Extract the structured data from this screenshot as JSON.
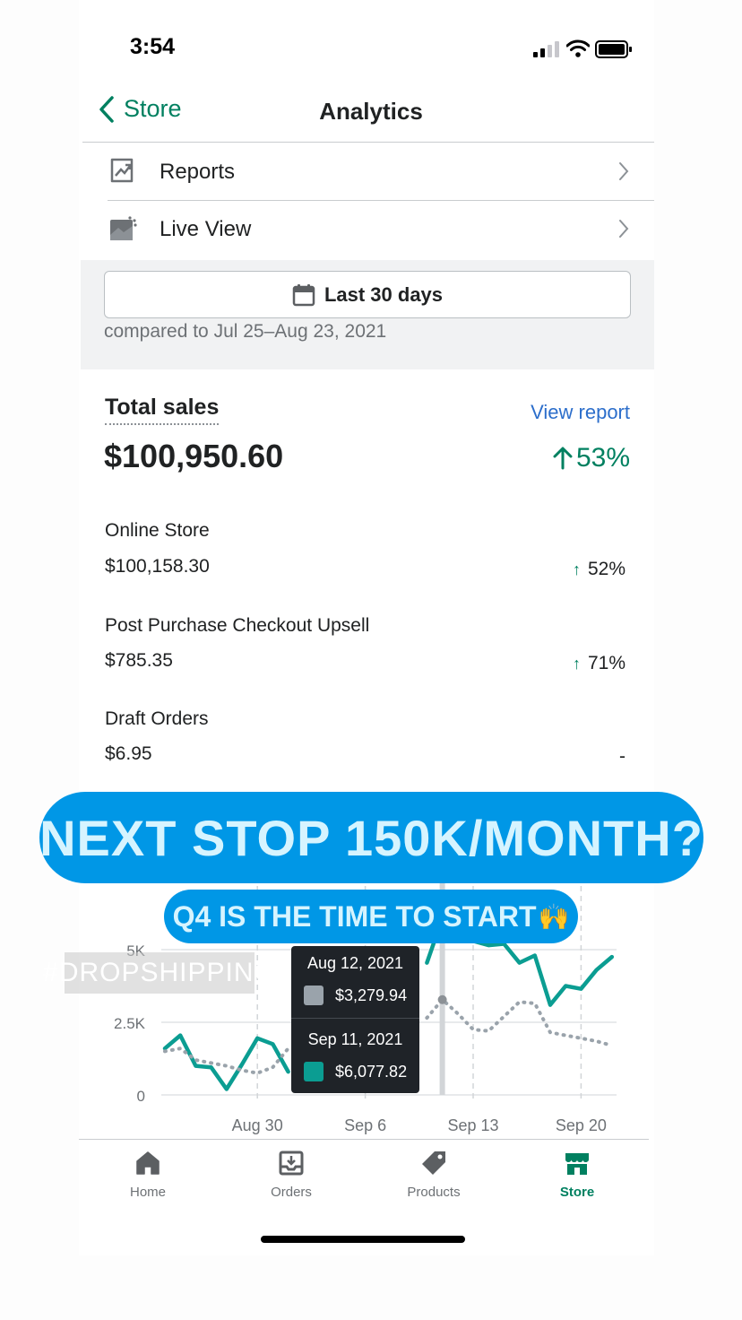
{
  "status": {
    "time": "3:54"
  },
  "nav": {
    "back_label": "Store",
    "title": "Analytics"
  },
  "menu": [
    {
      "label": "Reports",
      "icon": "reports-icon"
    },
    {
      "label": "Live View",
      "icon": "live-view-icon"
    }
  ],
  "date_filter": {
    "label": "Last 30 days",
    "compared": "compared to Jul 25–Aug 23, 2021"
  },
  "total_sales": {
    "label": "Total sales",
    "view_report": "View report",
    "value": "$100,950.60",
    "change": "53%"
  },
  "channels": [
    {
      "name": "Online Store",
      "value": "$100,158.30",
      "change": "52%"
    },
    {
      "name": "Post Purchase Checkout Upsell",
      "value": "$785.35",
      "change": "71%"
    },
    {
      "name": "Draft Orders",
      "value": "$6.95",
      "change": "-"
    }
  ],
  "overlay": {
    "headline": "NEXT STOP 150K/MONTH?",
    "subline": "Q4 IS THE TIME TO START",
    "subline_emoji": "🙌",
    "hashtag": "#DROPSHIPPING"
  },
  "chart_data": {
    "type": "line",
    "x_ticks": [
      "Aug 30",
      "Sep 6",
      "Sep 13",
      "Sep 20"
    ],
    "y_ticks": [
      "0",
      "2.5K",
      "5K"
    ],
    "ylim": [
      0,
      6000
    ],
    "grid": true,
    "series": [
      {
        "color": "#0b9d92",
        "style": "solid",
        "points": [
          [
            "2021-08-24",
            1600
          ],
          [
            "2021-08-25",
            2050
          ],
          [
            "2021-08-26",
            1000
          ],
          [
            "2021-08-27",
            950
          ],
          [
            "2021-08-28",
            200
          ],
          [
            "2021-08-29",
            1050
          ],
          [
            "2021-08-30",
            1950
          ],
          [
            "2021-08-31",
            1750
          ],
          [
            "2021-09-01",
            800
          ],
          [
            "2021-09-10",
            4550
          ],
          [
            "2021-09-11",
            6077.82
          ],
          [
            "2021-09-12",
            5750
          ],
          [
            "2021-09-13",
            5300
          ],
          [
            "2021-09-14",
            5150
          ],
          [
            "2021-09-15",
            5200
          ],
          [
            "2021-09-16",
            4550
          ],
          [
            "2021-09-17",
            4800
          ],
          [
            "2021-09-18",
            3100
          ],
          [
            "2021-09-19",
            3750
          ],
          [
            "2021-09-20",
            3650
          ],
          [
            "2021-09-21",
            4300
          ],
          [
            "2021-09-22",
            4750
          ]
        ]
      },
      {
        "color": "#9aa3ab",
        "style": "dotted",
        "points": [
          [
            "2021-08-24",
            1500
          ],
          [
            "2021-08-25",
            1600
          ],
          [
            "2021-08-26",
            1200
          ],
          [
            "2021-08-27",
            1100
          ],
          [
            "2021-08-28",
            1000
          ],
          [
            "2021-08-29",
            850
          ],
          [
            "2021-08-30",
            750
          ],
          [
            "2021-08-31",
            950
          ],
          [
            "2021-09-01",
            1600
          ],
          [
            "2021-09-10",
            2650
          ],
          [
            "2021-09-11",
            3279.94
          ],
          [
            "2021-09-12",
            2800
          ],
          [
            "2021-09-13",
            2250
          ],
          [
            "2021-09-14",
            2200
          ],
          [
            "2021-09-15",
            2700
          ],
          [
            "2021-09-16",
            3200
          ],
          [
            "2021-09-17",
            3150
          ],
          [
            "2021-09-18",
            2150
          ],
          [
            "2021-09-19",
            2050
          ],
          [
            "2021-09-20",
            1950
          ],
          [
            "2021-09-21",
            1850
          ],
          [
            "2021-09-22",
            1700
          ]
        ]
      }
    ],
    "tooltip": {
      "rows": [
        {
          "date": "Aug 12, 2021",
          "value": "$3,279.94",
          "color": "#9aa3ab"
        },
        {
          "date": "Sep 11, 2021",
          "value": "$6,077.82",
          "color": "#0b9d92"
        }
      ]
    }
  },
  "tabs": [
    {
      "label": "Home",
      "icon": "home-icon"
    },
    {
      "label": "Orders",
      "icon": "orders-icon"
    },
    {
      "label": "Products",
      "icon": "tag-icon"
    },
    {
      "label": "Store",
      "icon": "store-icon"
    }
  ]
}
